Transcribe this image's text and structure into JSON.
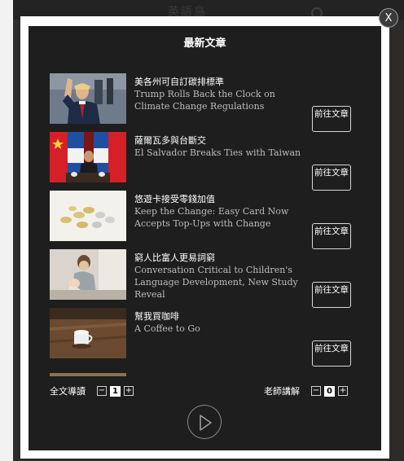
{
  "modal": {
    "title": "最新文章",
    "close_label": "X"
  },
  "articles": [
    {
      "title_zh": "美各州可自訂碳排標準",
      "title_en": "Trump Rolls Back the Clock on Climate Change Regulations",
      "button": "前往文章",
      "thumb_icon": "photo-president-waving"
    },
    {
      "title_zh": "薩爾瓦多與台斷交",
      "title_en": "El Salvador Breaks Ties with Taiwan",
      "button": "前往文章",
      "thumb_icon": "photo-flags-press-conference"
    },
    {
      "title_zh": "悠遊卡接受零錢加值",
      "title_en": "Keep the Change: Easy Card Now Accepts Top-Ups with Change",
      "button": "前往文章",
      "thumb_icon": "photo-coins"
    },
    {
      "title_zh": "窮人比富人更易詞窮",
      "title_en": "Conversation Critical to Children's Language Development, New Study Reveal",
      "button": "前往文章",
      "thumb_icon": "photo-mother-child"
    },
    {
      "title_zh": "幫我買咖啡",
      "title_en": "A Coffee to Go",
      "button": "前往文章",
      "thumb_icon": "photo-coffee-cup"
    }
  ],
  "controls": {
    "left": {
      "label": "全文導讀",
      "minus": "−",
      "value": "1",
      "plus": "+"
    },
    "right": {
      "label": "老師講解",
      "minus": "−",
      "value": "0",
      "plus": "+"
    }
  },
  "backdrop": {
    "ghost_title": "英語島"
  },
  "colors": {
    "modal_frame": "#ffffff",
    "modal_body": "#1e1e1e",
    "subtitle": "#bdbdbd"
  }
}
